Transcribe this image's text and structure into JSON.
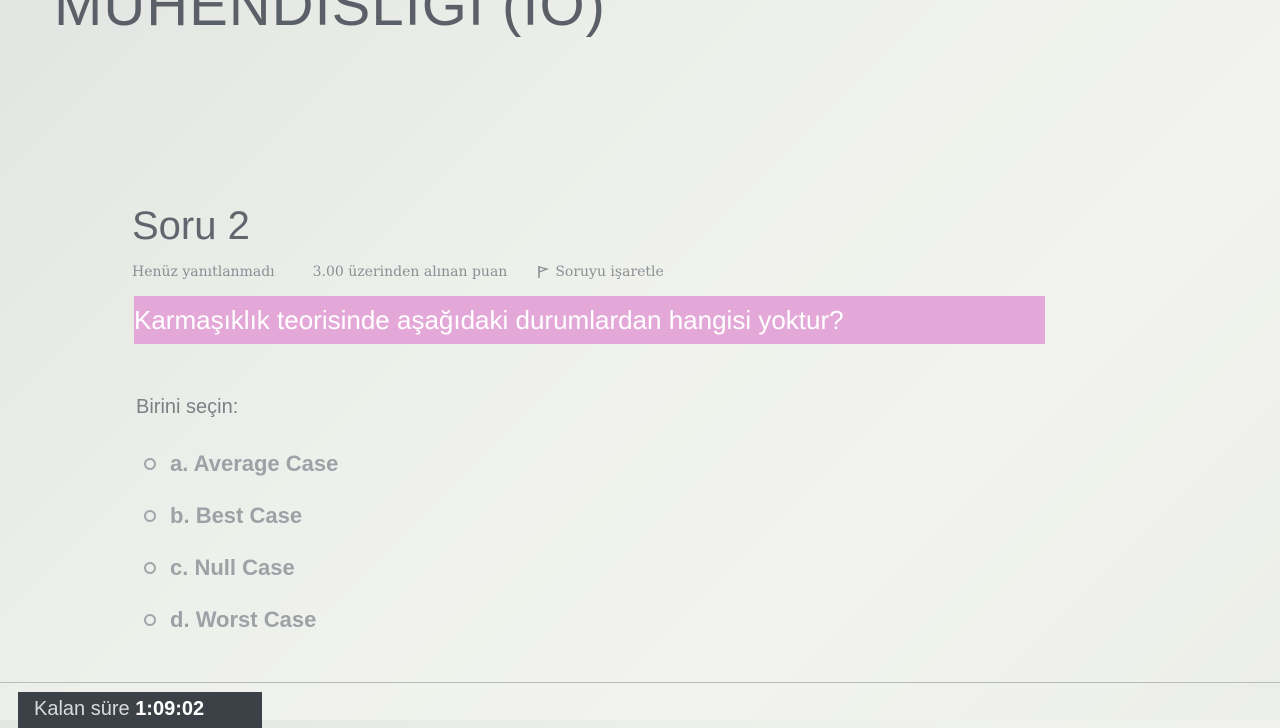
{
  "course": {
    "title": "MÜHENDİSLİĞİ (İÖ)"
  },
  "question": {
    "heading": "Soru 2",
    "status": "Henüz yanıtlanmadı",
    "points": "3.00 üzerinden alınan puan",
    "flag_label": "Soruyu işaretle",
    "text": "Karmaşıklık teorisinde aşağıdaki durumlardan hangisi yoktur?",
    "highlight_color": "#e4a8d8"
  },
  "answers": {
    "prompt": "Birini seçin:",
    "options": [
      {
        "letter": "a.",
        "label": "Average Case"
      },
      {
        "letter": "b.",
        "label": "Best Case"
      },
      {
        "letter": "c.",
        "label": "Null Case"
      },
      {
        "letter": "d.",
        "label": "Worst Case"
      }
    ]
  },
  "timer": {
    "label": "Kalan süre",
    "value": "1:09:02"
  }
}
